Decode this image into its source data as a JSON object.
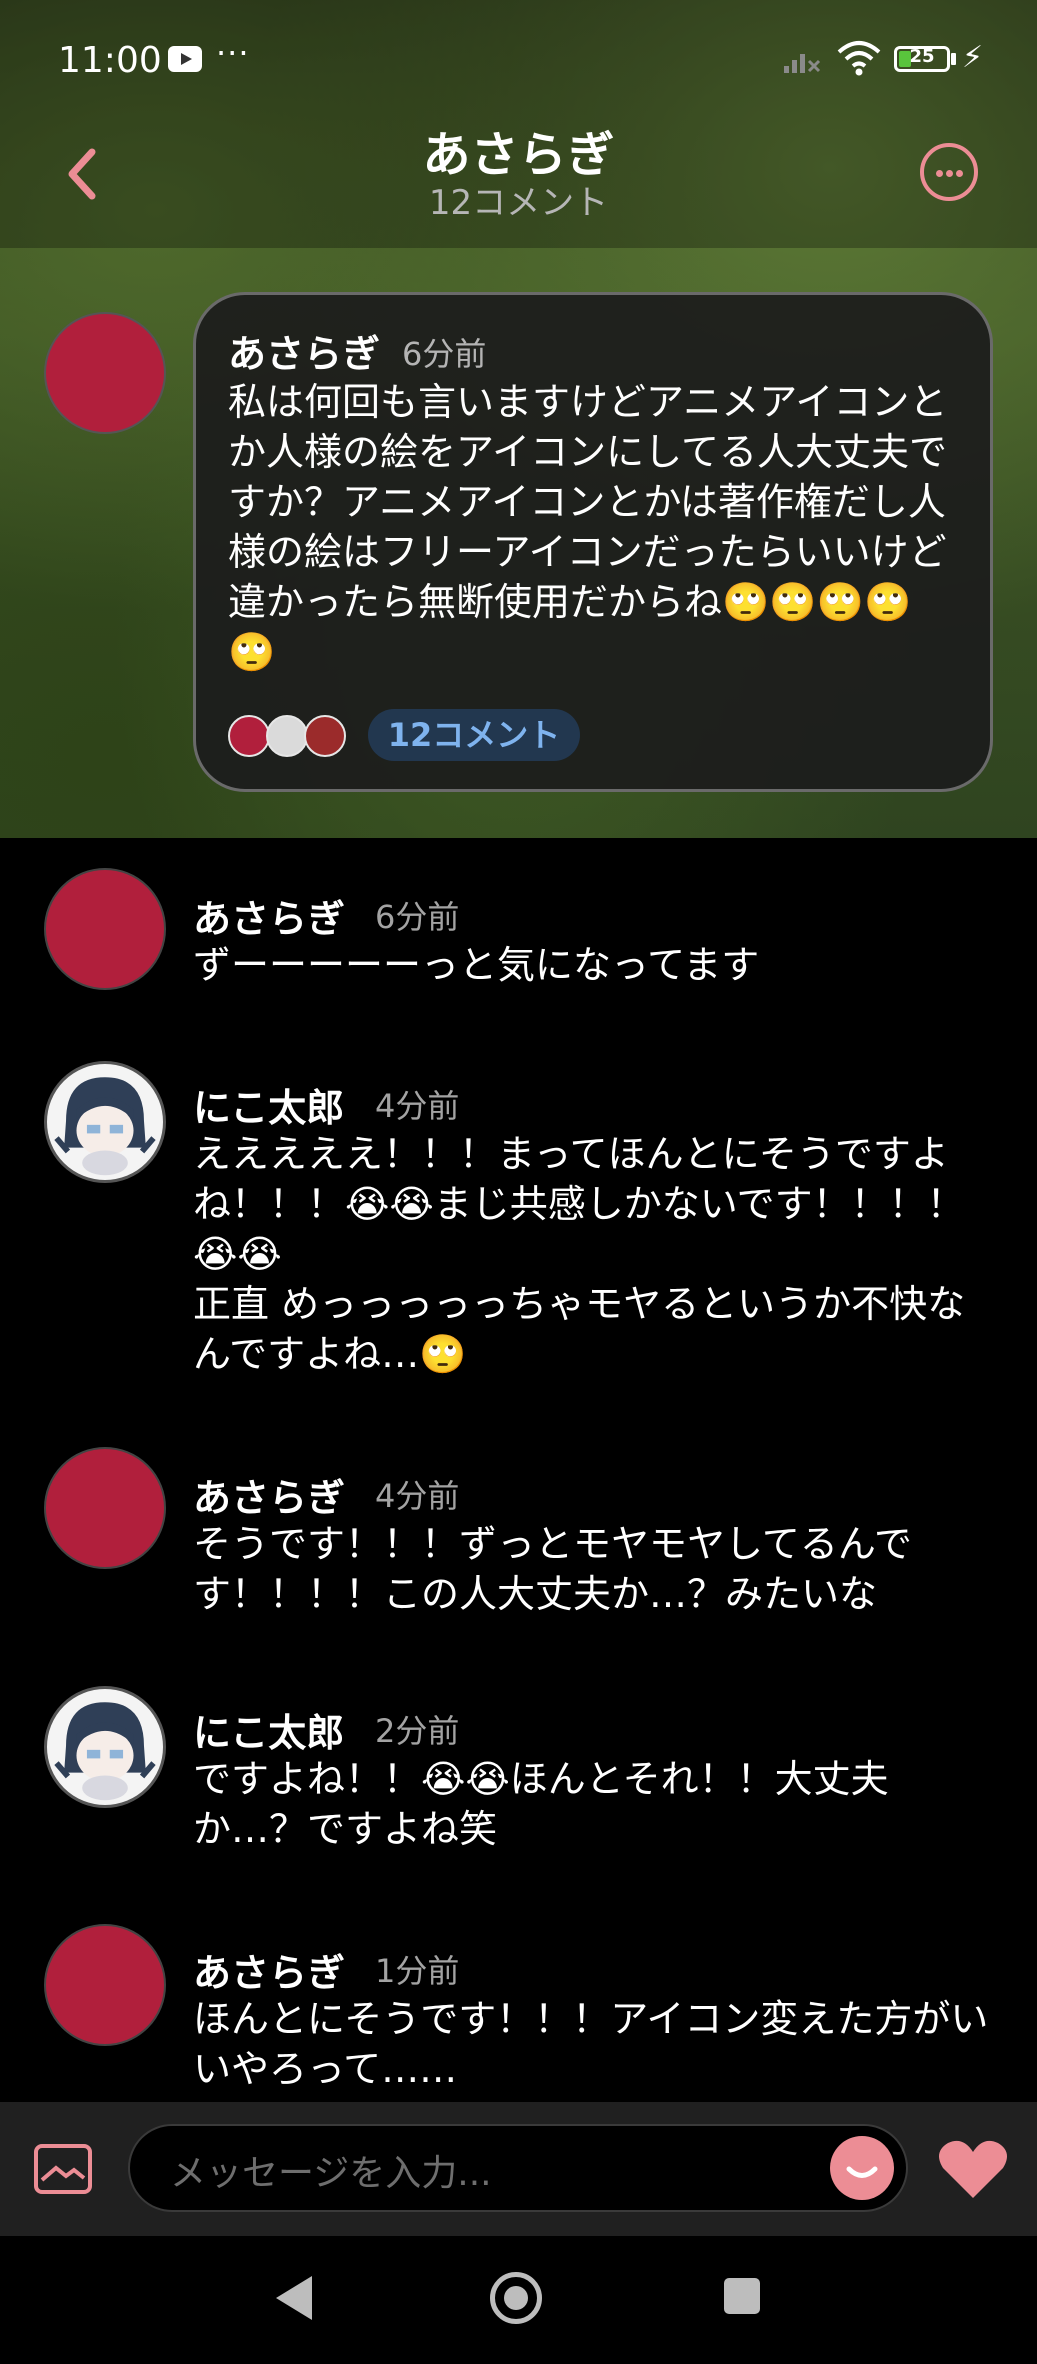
{
  "status": {
    "time": "11:00",
    "battery": "25"
  },
  "header": {
    "title": "あさらぎ",
    "subtitle": "12コメント"
  },
  "post": {
    "author": "あさらぎ",
    "time": "6分前",
    "text": "私は何回も言いますけどアニメアイコンとか人様の絵をアイコンにしてる人大丈夫ですか？アニメアイコンとかは著作権だし人様の絵はフリーアイコンだったらいいけど違かったら無断使用だからね🙄🙄🙄🙄🙄",
    "comment_chip": "12コメント"
  },
  "comments": [
    {
      "author": "あさらぎ",
      "time": "6分前",
      "text": "ずーーーーーっと気になってます"
    },
    {
      "author": "にこ太郎",
      "time": "4分前",
      "text": "えええええ！！！まってほんとにそうですよね！！！😭😭まじ共感しかないです！！！！😭😭\n正直 めっっっっっちゃモヤるというか不快なんですよね…🙄"
    },
    {
      "author": "あさらぎ",
      "time": "4分前",
      "text": "そうです！！！ずっとモヤモヤしてるんです！！！！この人大丈夫か…？みたいな"
    },
    {
      "author": "にこ太郎",
      "time": "2分前",
      "text": "ですよね！！😭😭ほんとそれ！！大丈夫か…？ですよね笑"
    },
    {
      "author": "あさらぎ",
      "time": "1分前",
      "text": "ほんとにそうです！！！アイコン変えた方がいいやろって……"
    }
  ],
  "composer": {
    "placeholder": "メッセージを入力..."
  },
  "colors": {
    "accent": "#ec8d95",
    "avatar_red": "#b11f3c",
    "chip_bg": "#22374f",
    "chip_text": "#7fb3ee"
  },
  "icons": [
    "back-chevron-icon",
    "more-icon",
    "image-icon",
    "smiley-icon",
    "heart-icon",
    "nav-back-icon",
    "nav-home-icon",
    "nav-recents-icon"
  ]
}
